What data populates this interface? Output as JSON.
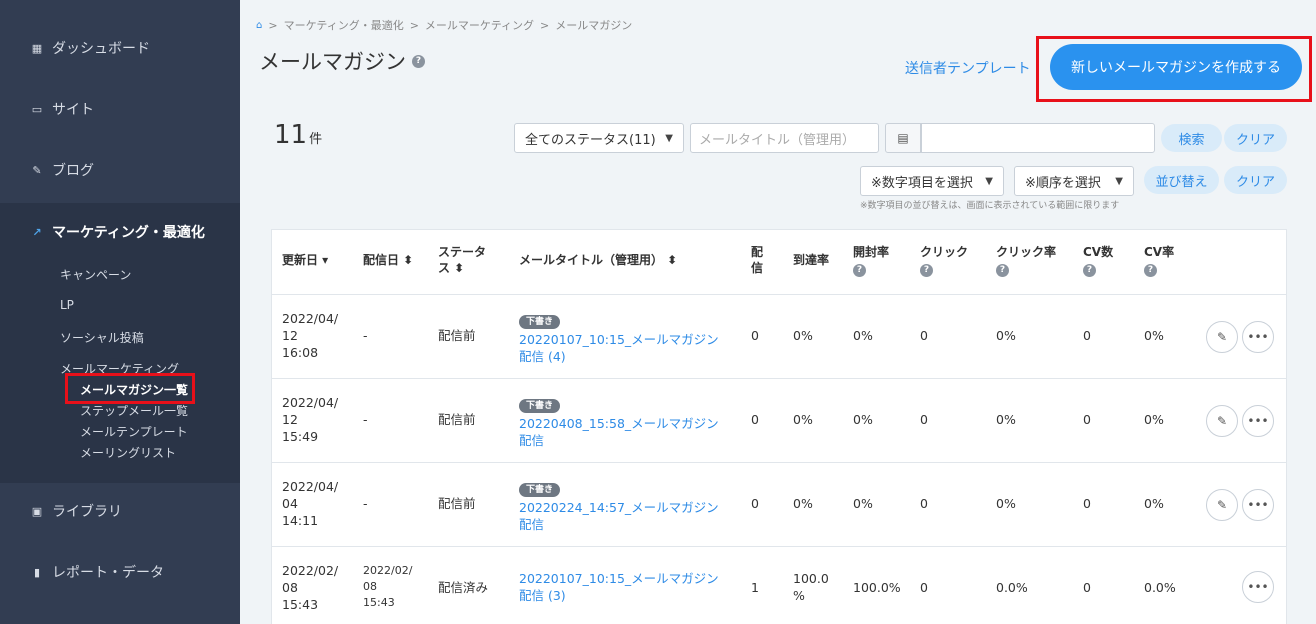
{
  "sidebar": {
    "items": [
      {
        "label": "ダッシュボード",
        "icon": "dashboard-icon"
      },
      {
        "label": "サイト",
        "icon": "site-icon"
      },
      {
        "label": "ブログ",
        "icon": "pencil-icon"
      },
      {
        "label": "マーケティング・最適化",
        "icon": "trend-icon"
      },
      {
        "label": "ライブラリ",
        "icon": "image-icon"
      },
      {
        "label": "レポート・データ",
        "icon": "bar-chart-icon"
      }
    ],
    "sub_items": [
      "キャンペーン",
      "LP",
      "ソーシャル投稿",
      "メールマーケティング"
    ],
    "mail_items": [
      "メールマガジン一覧",
      "ステップメール一覧",
      "メールテンプレート",
      "メーリングリスト"
    ]
  },
  "breadcrumb": [
    "マーケティング・最適化",
    "メールマーケティング",
    "メールマガジン"
  ],
  "page_title": "メールマガジン",
  "sender_template_link": "送信者テンプレート",
  "create_button": "新しいメールマガジンを作成する",
  "count": {
    "value": "11",
    "unit": "件"
  },
  "filters": {
    "status_select": "全てのステータス(11)",
    "title_placeholder": "メールタイトル（管理用）",
    "search_button": "検索",
    "clear_button": "クリア",
    "numeric_select": "※数字項目を選択",
    "order_select": "※順序を選択",
    "sort_button": "並び替え",
    "clear_button2": "クリア",
    "note": "※数字項目の並び替えは、画面に表示されている範囲に限ります"
  },
  "table": {
    "headers": {
      "updated": "更新日 ▾",
      "sent": "配信日 ⬍",
      "status_1": "ステータ",
      "status_2": "ス ⬍",
      "title": "メールタイトル（管理用） ⬍",
      "delivery_1": "配",
      "delivery_2": "信",
      "reach": "到達率",
      "open": "開封率",
      "click": "クリック",
      "ctr": "クリック率",
      "cv": "CV数",
      "cvr": "CV率"
    },
    "draft_badge": "下書き",
    "rows": [
      {
        "date1": "2022/04/",
        "date2": "12",
        "date3": "16:08",
        "sent": "-",
        "status": "配信前",
        "title": "20220107_10:15_メールマガジン配信 (4)",
        "draft": true,
        "delivery": "0",
        "reach": "0%",
        "open": "0%",
        "click": "0",
        "ctr": "0%",
        "cv": "0",
        "cvr": "0%"
      },
      {
        "date1": "2022/04/",
        "date2": "12",
        "date3": "15:49",
        "sent": "-",
        "status": "配信前",
        "title": "20220408_15:58_メールマガジン配信",
        "draft": true,
        "delivery": "0",
        "reach": "0%",
        "open": "0%",
        "click": "0",
        "ctr": "0%",
        "cv": "0",
        "cvr": "0%"
      },
      {
        "date1": "2022/04/",
        "date2": "04",
        "date3": "14:11",
        "sent": "-",
        "status": "配信前",
        "title": "20220224_14:57_メールマガジン配信",
        "draft": true,
        "delivery": "0",
        "reach": "0%",
        "open": "0%",
        "click": "0",
        "ctr": "0%",
        "cv": "0",
        "cvr": "0%"
      },
      {
        "date1": "2022/02/",
        "date2": "08",
        "date3": "15:43",
        "sent1": "2022/02/",
        "sent2": "08",
        "sent3": "15:43",
        "status": "配信済み",
        "title": "20220107_10:15_メールマガジン配信 (3)",
        "draft": false,
        "delivery": "1",
        "reach1": "100.0",
        "reach2": "%",
        "open": "100.0%",
        "click": "0",
        "ctr": "0.0%",
        "cv": "0",
        "cvr": "0.0%"
      }
    ]
  },
  "colors": {
    "sidebar_bg": "#323d52",
    "accent": "#2a92ef",
    "highlight": "#e8101a"
  }
}
